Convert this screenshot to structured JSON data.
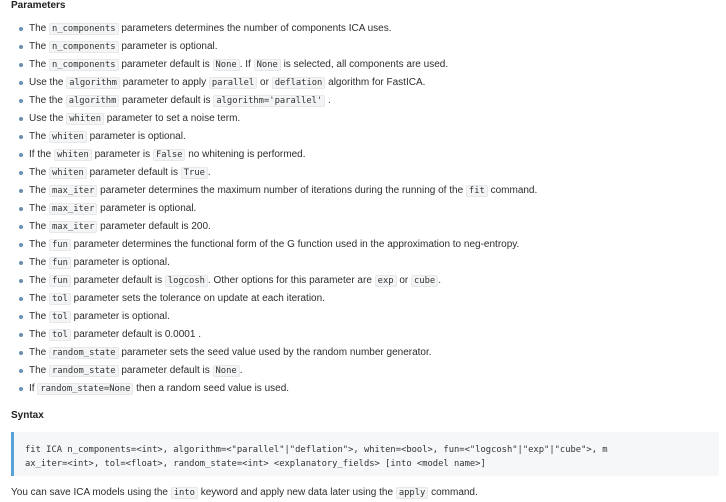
{
  "headings": {
    "parameters": "Parameters",
    "syntax": "Syntax"
  },
  "params": [
    {
      "a": "The ",
      "c1": "n_components",
      "b": " parameters determines the number of components ICA uses."
    },
    {
      "a": "The ",
      "c1": "n_components",
      "b": " parameter is optional."
    },
    {
      "a": "The ",
      "c1": "n_components",
      "b": " parameter default is ",
      "c2": "None",
      "d": ". If ",
      "c3": "None",
      "e": " is selected, all components are used."
    },
    {
      "a": "Use the ",
      "c1": "algorithm",
      "b": " parameter to apply ",
      "c2": "parallel",
      "d": " or ",
      "c3": "deflation",
      "e": " algorithm for FastICA."
    },
    {
      "a": "The the ",
      "c1": "algorithm",
      "b": " parameter default is ",
      "c2": "algorithm='parallel'",
      "d": " ."
    },
    {
      "a": "Use the ",
      "c1": "whiten",
      "b": " parameter to set a noise term."
    },
    {
      "a": "The ",
      "c1": "whiten",
      "b": " parameter is optional."
    },
    {
      "a": "If the ",
      "c1": "whiten",
      "b": " parameter is ",
      "c2": "False",
      "d": " no whitening is performed."
    },
    {
      "a": "The ",
      "c1": "whiten",
      "b": " parameter default is ",
      "c2": "True",
      "d": "."
    },
    {
      "a": "The ",
      "c1": "max_iter",
      "b": " parameter determines the maximum number of iterations during the running of the ",
      "c2": "fit",
      "d": " command."
    },
    {
      "a": "The ",
      "c1": "max_iter",
      "b": " parameter is optional."
    },
    {
      "a": "The ",
      "c1": "max_iter",
      "b": " parameter default is 200."
    },
    {
      "a": "The ",
      "c1": "fun",
      "b": " parameter determines the functional form of the G function used in the approximation to neg-entropy."
    },
    {
      "a": "The ",
      "c1": "fun",
      "b": " parameter is optional."
    },
    {
      "a": "The ",
      "c1": "fun",
      "b": " parameter default is ",
      "c2": "logcosh",
      "d": ". Other options for this parameter are ",
      "c3": "exp",
      "e": " or ",
      "c4": "cube",
      "f": "."
    },
    {
      "a": "The ",
      "c1": "tol",
      "b": " parameter sets the tolerance on update at each iteration."
    },
    {
      "a": "The ",
      "c1": "tol",
      "b": " parameter is optional."
    },
    {
      "a": "The ",
      "c1": "tol",
      "b": " parameter default is 0.0001 ."
    },
    {
      "a": "The ",
      "c1": "random_state",
      "b": " parameter sets the seed value used by the random number generator."
    },
    {
      "a": "The ",
      "c1": "random_state",
      "b": " parameter default is ",
      "c2": "None",
      "d": "."
    },
    {
      "a": "If ",
      "c1": "random_state=None",
      "b": " then a random seed value is used."
    }
  ],
  "syntax": {
    "line1": "fit ICA n_components=<int>, algorithm=<\"parallel\"|\"deflation\">, whiten=<bool>, fun=<\"logcosh\"|\"exp\"|\"cube\">, m",
    "line2": "ax_iter=<int>, tol=<float>, random_state=<int> <explanatory_fields> [into <model name>]"
  },
  "footer": {
    "a": "You can save ICA models using the ",
    "c1": "into",
    "b": " keyword and apply new data later using the ",
    "c2": "apply",
    "d": " command."
  }
}
